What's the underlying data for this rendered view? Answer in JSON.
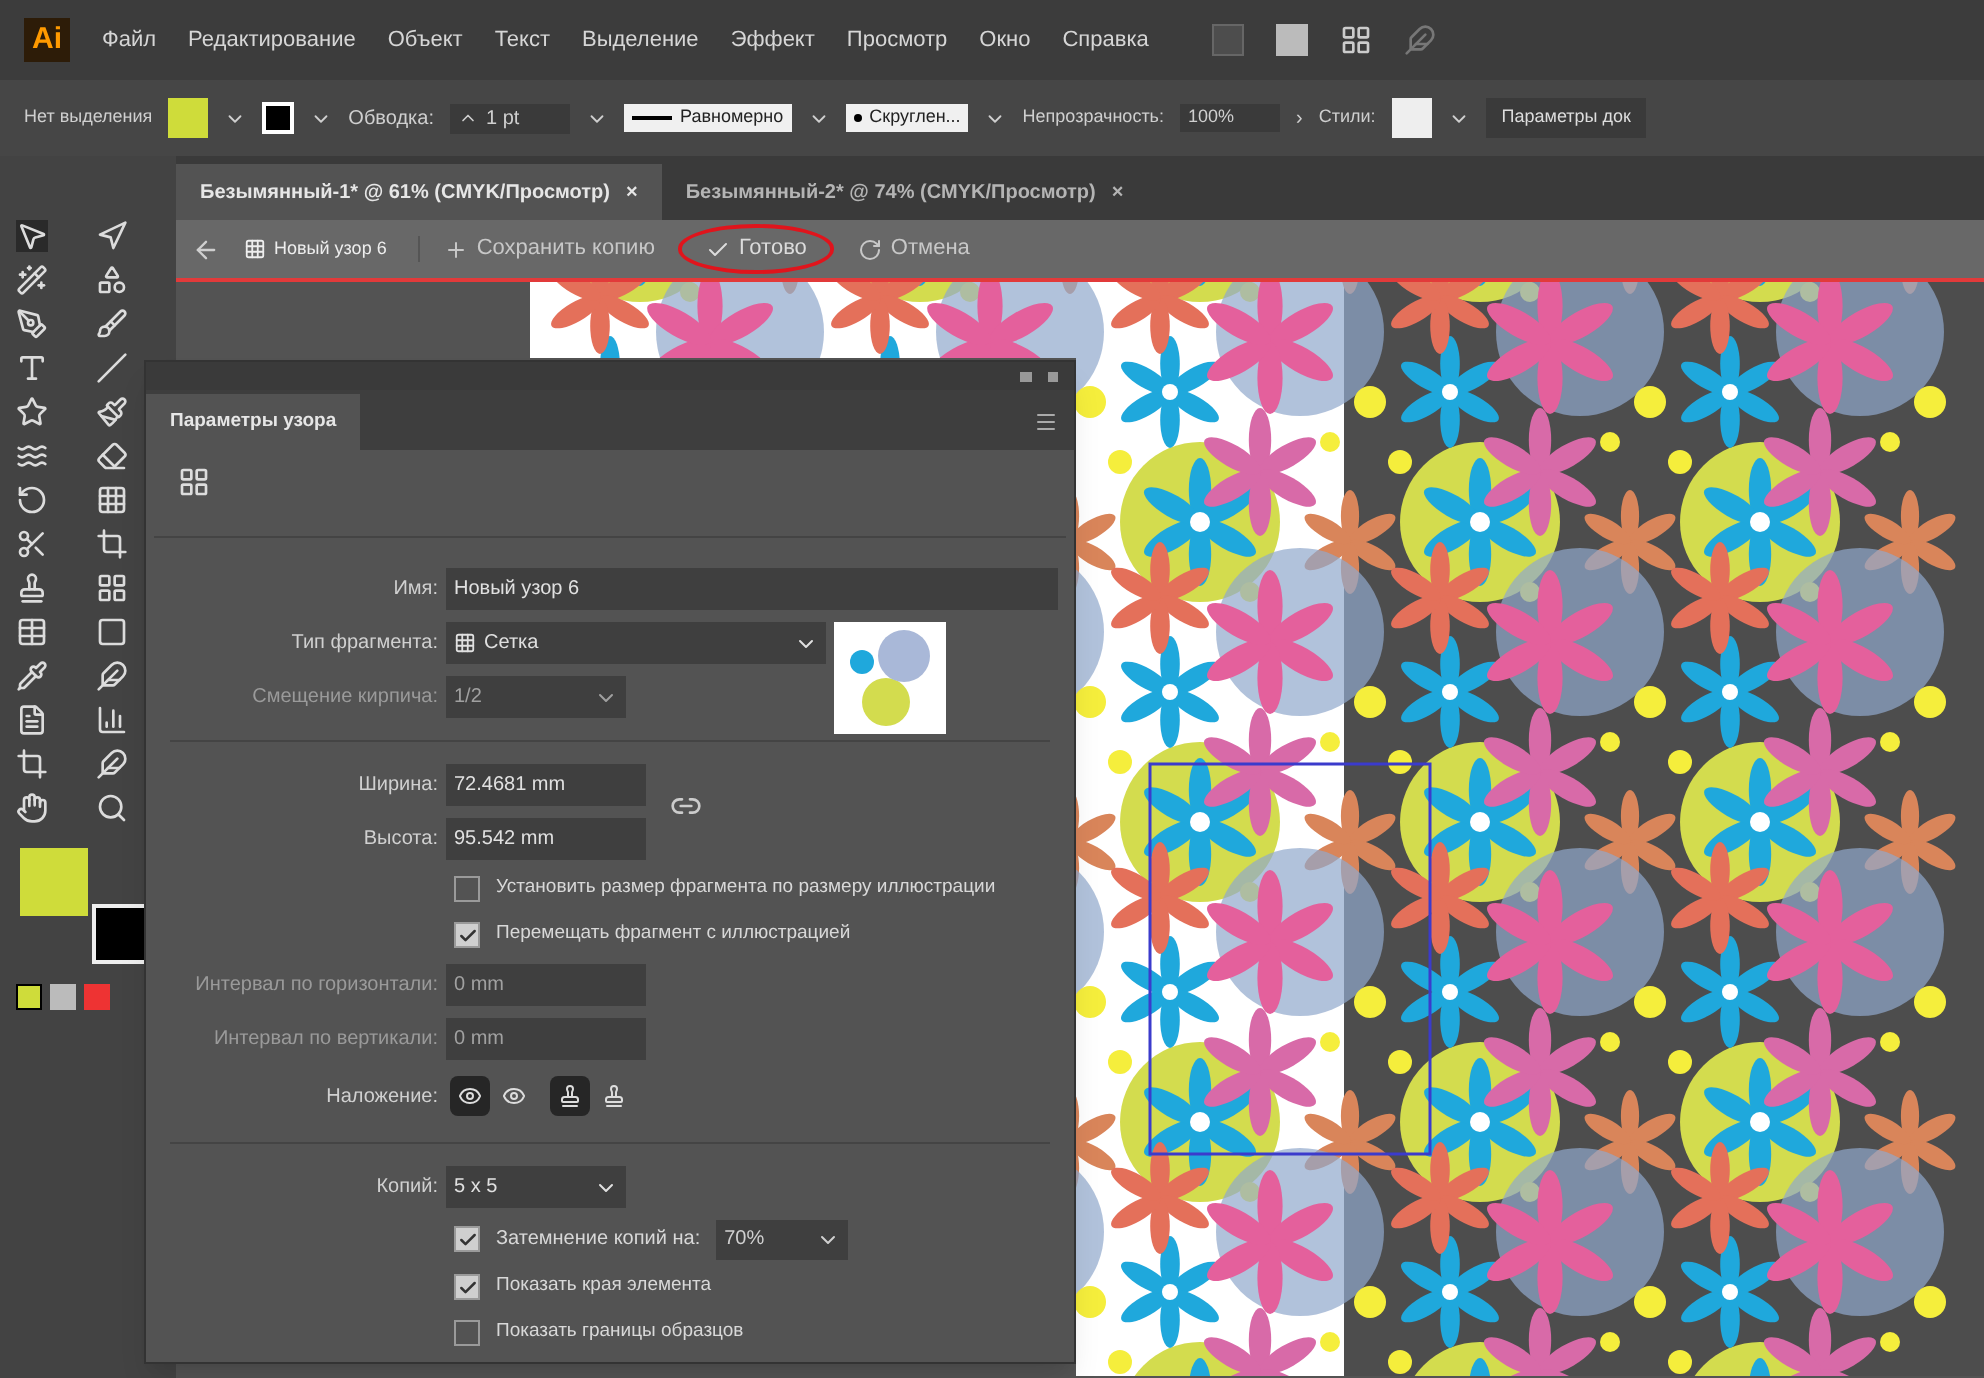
{
  "app_logo": "Ai",
  "menu": [
    "Файл",
    "Редактирование",
    "Объект",
    "Текст",
    "Выделение",
    "Эффект",
    "Просмотр",
    "Окно",
    "Справка"
  ],
  "control_bar": {
    "selection": "Нет выделения",
    "stroke_label": "Обводка:",
    "stroke_weight": "1 pt",
    "profile": "Равномерно",
    "brush": "Скруглен...",
    "opacity_label": "Непрозрачность:",
    "opacity": "100%",
    "opacity_arrow": "›",
    "styles_label": "Стили:",
    "document_settings": "Параметры док"
  },
  "document_tabs": [
    {
      "label": "Безымянный-1* @ 61% (CMYK/Просмотр)",
      "close": "×",
      "selected": true
    },
    {
      "label": "Безымянный-2* @ 74% (CMYK/Просмотр)",
      "close": "×",
      "selected": false
    }
  ],
  "pattern_bar": {
    "pattern_name": "Новый узор 6",
    "save_copy": "Сохранить копию",
    "done": "Готово",
    "cancel": "Отмена"
  },
  "panel": {
    "title": "Параметры узора",
    "rows": [
      {
        "kind": "text",
        "label": "Имя:",
        "value": "Новый узор 6",
        "disabled": false
      },
      {
        "kind": "select",
        "label": "Тип фрагмента:",
        "value": "Сетка",
        "disabled": false
      },
      {
        "kind": "select",
        "label": "Смещение кирпича:",
        "value": "1/2",
        "disabled": true
      },
      {
        "kind": "divider"
      },
      {
        "kind": "text",
        "label": "Ширина:",
        "value": "72.4681 mm",
        "disabled": false
      },
      {
        "kind": "text",
        "label": "Высота:",
        "value": "95.542 mm",
        "disabled": false
      },
      {
        "kind": "checkbox",
        "label": "Установить размер фрагмента по размеру иллюстрации",
        "checked": false
      },
      {
        "kind": "checkbox",
        "label": "Перемещать фрагмент с иллюстрацией",
        "checked": true
      },
      {
        "kind": "text",
        "label": "Интервал по горизонтали:",
        "value": "0 mm",
        "disabled": true
      },
      {
        "kind": "text",
        "label": "Интервал по вертикали:",
        "value": "0 mm",
        "disabled": true
      },
      {
        "kind": "overlap",
        "label": "Наложение:",
        "options": [
          {
            "selected": true
          },
          {
            "selected": false
          },
          {
            "selected": true
          },
          {
            "selected": false
          }
        ]
      },
      {
        "kind": "divider"
      },
      {
        "kind": "select",
        "label": "Копий:",
        "value": "5 x 5",
        "disabled": false
      },
      {
        "kind": "checkbox_select",
        "label": "Затемнение копий на:",
        "checked": true,
        "value": "70%"
      },
      {
        "kind": "checkbox",
        "label": "Показать края элемента",
        "checked": true
      },
      {
        "kind": "checkbox",
        "label": "Показать границы образцов",
        "checked": false
      }
    ]
  }
}
